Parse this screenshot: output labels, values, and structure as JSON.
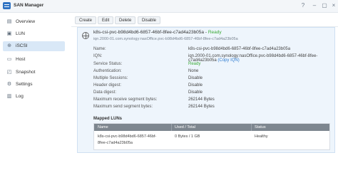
{
  "window": {
    "title": "SAN Manager"
  },
  "colors": {
    "accent": "#2e7bd1",
    "ready_green": "#3aa935",
    "active_nav": "#d9e8f7",
    "table_header": "#7d868f"
  },
  "sidebar": {
    "items": [
      {
        "label": "Overview",
        "icon": "overview-icon"
      },
      {
        "label": "LUN",
        "icon": "lun-icon"
      },
      {
        "label": "iSCSI",
        "icon": "iscsi-icon"
      },
      {
        "label": "Host",
        "icon": "host-icon"
      },
      {
        "label": "Snapshot",
        "icon": "snapshot-icon"
      },
      {
        "label": "Settings",
        "icon": "gear-icon"
      },
      {
        "label": "Log",
        "icon": "log-icon"
      }
    ],
    "active": "iSCSI"
  },
  "toolbar": {
    "create": "Create",
    "edit": "Edit",
    "delete": "Delete",
    "disable": "Disable"
  },
  "target": {
    "name": "k8s-csi-pvc-b98d4bd6-6857-46bf-8fee-c7ad4a23b05a",
    "separator": " - ",
    "status": "Ready",
    "iqn_sub": "iqn.2000-01.com.synology:nasOffice.pvc-b98d4bd6-6857-46bf-8fee-c7ad4a23b05a"
  },
  "details": [
    {
      "label": "Name:",
      "value": "k8s-csi-pvc-b98d4bd6-6857-46bf-8fee-c7ad4a23b05a"
    },
    {
      "label": "IQN:",
      "value": "iqn.2000-01.com.synology:nasOffice.pvc-b98d4bd6-6857-46bf-8fee-c7ad4a23b05a",
      "link": "(Copy IQN)"
    },
    {
      "label": "Service Status:",
      "value": "Ready"
    },
    {
      "label": "Authentication:",
      "value": "None"
    },
    {
      "label": "Multiple Sessions:",
      "value": "Disable"
    },
    {
      "label": "Header digest:",
      "value": "Disable"
    },
    {
      "label": "Data digest:",
      "value": "Disable"
    },
    {
      "label": "Maximum receive segment bytes:",
      "value": "262144 Bytes"
    },
    {
      "label": "Maximum send segment bytes:",
      "value": "262144 Bytes"
    }
  ],
  "mapped_luns": {
    "title": "Mapped LUNs",
    "columns": [
      "Name",
      "Used / Total",
      "Status"
    ],
    "rows": [
      {
        "name_line1": "k8s-csi-pvc-b98d4bd6-6857-46bf-",
        "name_line2": "8fee-c7ad4a23b05a",
        "used_total": "0 Bytes / 1 GB",
        "status": "Healthy"
      }
    ]
  }
}
